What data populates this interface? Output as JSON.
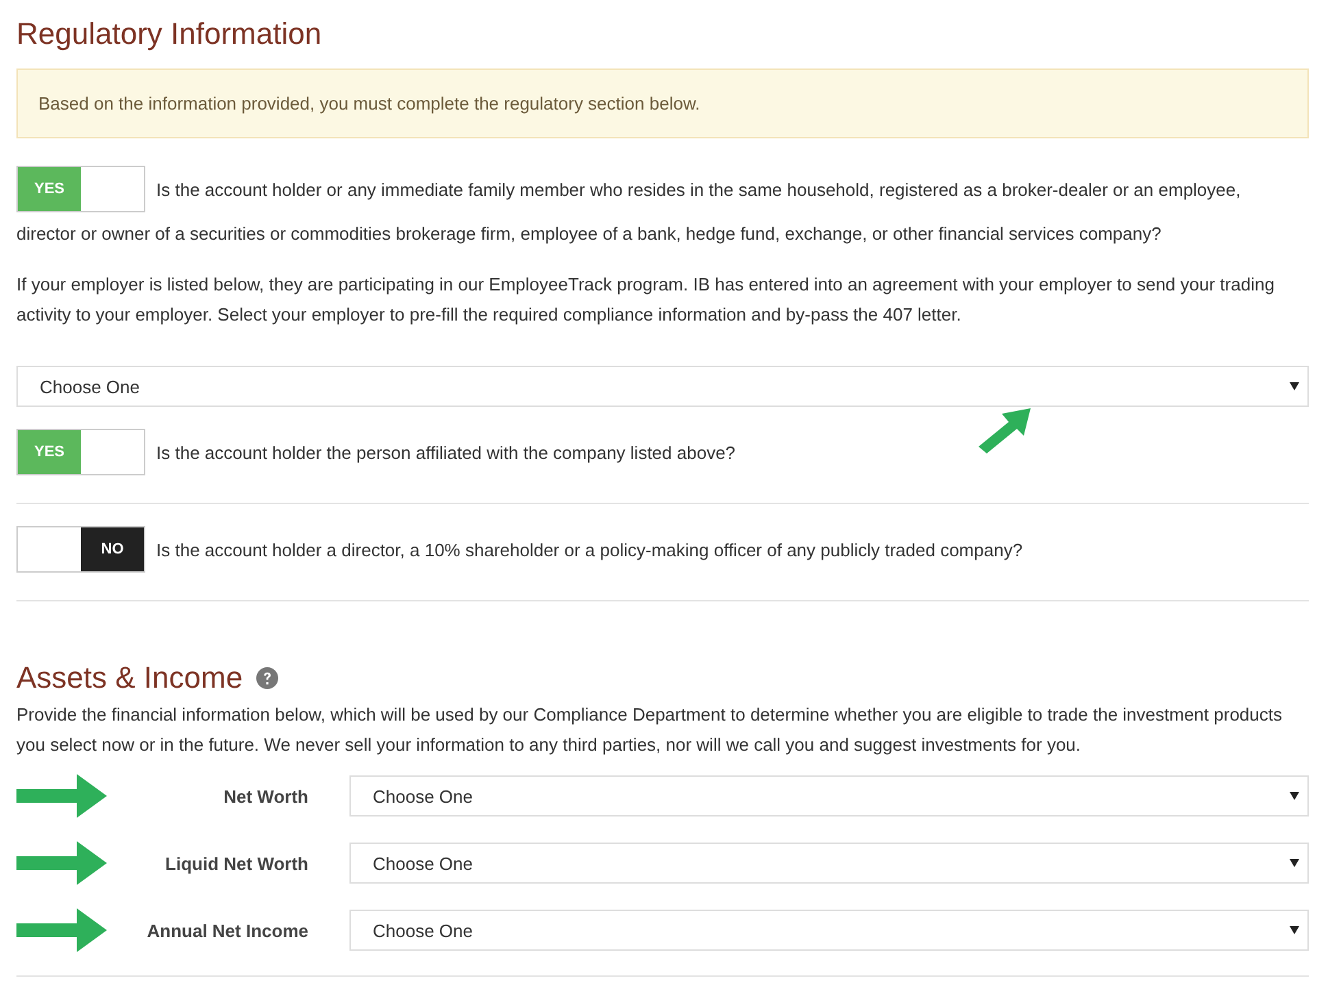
{
  "regulatory": {
    "title": "Regulatory Information",
    "notice": "Based on the information provided, you must complete the regulatory section below.",
    "questions": [
      {
        "kind": "toggle_wrapped",
        "toggle": "YES",
        "on": true,
        "text": "Is the account holder or any immediate family member who resides in the same household, registered as a broker-dealer or an employee,",
        "text_continued": "director or owner of a securities or commodities brokerage firm, employee of a bank, hedge fund, exchange, or other financial services company?"
      },
      {
        "kind": "paragraph",
        "text": "If your employer is listed below, they are participating in our EmployeeTrack program. IB has entered into an agreement with your employer to send your trading activity to your employer. Select your employer to pre-fill the required compliance information and by-pass the 407 letter."
      },
      {
        "kind": "select",
        "value": "Choose One"
      },
      {
        "kind": "toggle",
        "toggle": "YES",
        "on": true,
        "text": "Is the account holder the person affiliated with the company listed above?"
      },
      {
        "kind": "toggle",
        "toggle": "NO",
        "on": false,
        "text": "Is the account holder a director, a 10% shareholder or a policy-making officer of any publicly traded company?"
      }
    ]
  },
  "assets": {
    "title": "Assets & Income",
    "description": "Provide the financial information below, which will be used by our Compliance Department to determine whether you are eligible to trade the investment products you select now or in the future. We never sell your information to any third parties, nor will we call you and suggest investments for you.",
    "fields": [
      {
        "label": "Net Worth",
        "value": "Choose One"
      },
      {
        "label": "Liquid Net Worth",
        "value": "Choose One"
      },
      {
        "label": "Annual Net Income",
        "value": "Choose One"
      }
    ]
  }
}
